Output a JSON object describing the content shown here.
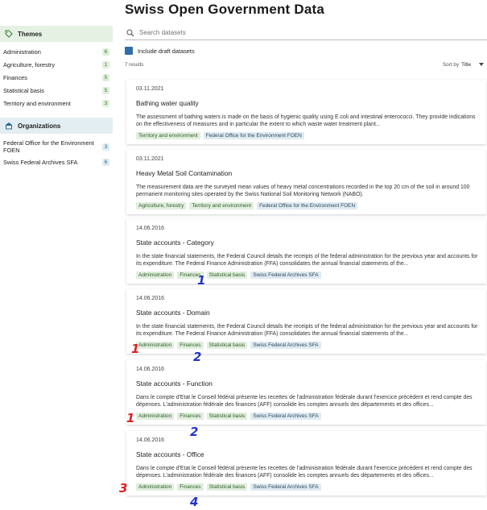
{
  "page": {
    "title": "Swiss Open Government Data"
  },
  "search": {
    "placeholder": "Search datasets"
  },
  "filters": {
    "include_draft_label": "Include draft datasets"
  },
  "results": {
    "count_label": "7 results",
    "sort_label": "Sort by",
    "sort_value": "Title"
  },
  "sidebar": {
    "themes_heading": "Themes",
    "themes": [
      {
        "label": "Administration",
        "count": "6"
      },
      {
        "label": "Agriculture, forestry",
        "count": "1"
      },
      {
        "label": "Finances",
        "count": "5"
      },
      {
        "label": "Statistical basis",
        "count": "5"
      },
      {
        "label": "Territory and environment",
        "count": "3"
      }
    ],
    "orgs_heading": "Organizations",
    "orgs": [
      {
        "label": "Federal Office for the Environment FOEN",
        "count": "3"
      },
      {
        "label": "Swiss Federal Archives SFA",
        "count": "6"
      }
    ]
  },
  "datasets": [
    {
      "date": "03.11.2021",
      "title": "Bathing water quality",
      "description": "The assessment of bathing waters is made on the basis of hygienic quality using E.coli and intestinal enterococci. They provide indications on the effectiveness of measures and in particular the extent to which waste water treatment plant...",
      "themes": [
        "Territory and environment"
      ],
      "orgs": [
        "Federal Office for the Environment FOEN"
      ]
    },
    {
      "date": "03.11.2021",
      "title": "Heavy Metal Soil Contamination",
      "description": "The measurement data are the surveyed mean values of heavy metal concentrations recorded in the top 20 cm of the soil in around 100 permanent monitoring sites operated by the Swiss National Soil Monitoring Network (NABO).",
      "themes": [
        "Agriculture, forestry",
        "Territory and environment"
      ],
      "orgs": [
        "Federal Office for the Environment FOEN"
      ]
    },
    {
      "date": "14.06.2016",
      "title": "State accounts - Category",
      "description": "In the state financial statements, the Federal Council details the receipts of the federal administration for the previous year and accounts for its expenditure. The Federal Finance Administration (FFA) consolidates the annual financial statements of the...",
      "themes": [
        "Administration",
        "Finances",
        "Statistical basis"
      ],
      "orgs": [
        "Swiss Federal Archives SFA"
      ]
    },
    {
      "date": "14.06.2016",
      "title": "State accounts - Domain",
      "description": "In the state financial statements, the Federal Council details the receipts of the federal administration for the previous year and accounts for its expenditure. The Federal Finance Administration (FFA) consolidates the annual financial statements of the...",
      "themes": [
        "Administration",
        "Finances",
        "Statistical basis"
      ],
      "orgs": [
        "Swiss Federal Archives SFA"
      ]
    },
    {
      "date": "14.06.2016",
      "title": "State accounts - Function",
      "description": "Dans le compte d'Etat le Conseil fédéral présente les recettes de l'administration fédérale durant l'exercice précédent et rend compte des dépenses. L'administration fédérale des finances (AFF) consolide les comptes annuels des départements et des offices...",
      "themes": [
        "Administration",
        "Finances",
        "Statistical basis"
      ],
      "orgs": [
        "Swiss Federal Archives SFA"
      ]
    },
    {
      "date": "14.06.2016",
      "title": "State accounts - Office",
      "description": "Dans le compte d'Etat le Conseil fédéral présente les recettes de l'administration fédérale durant l'exercice précédent et rend compte des dépenses. L'administration fédérale des finances (AFF) consolide les comptes annuels des départements et des offices...",
      "themes": [
        "Administration",
        "Finances",
        "Statistical basis"
      ],
      "orgs": [
        "Swiss Federal Archives SFA"
      ]
    }
  ],
  "annotations": [
    {
      "text": "1",
      "color": "#2233c9"
    },
    {
      "text": "1",
      "color": "#e01e1e"
    },
    {
      "text": "2",
      "color": "#2233c9"
    },
    {
      "text": "1",
      "color": "#e01e1e"
    },
    {
      "text": "2",
      "color": "#2233c9"
    },
    {
      "text": "3",
      "color": "#e01e1e"
    },
    {
      "text": "4",
      "color": "#2233c9"
    }
  ],
  "colors": {
    "theme_tag": "#e0efdd",
    "org_tag": "#dfeaf2",
    "checkbox": "#2e6fa8"
  }
}
